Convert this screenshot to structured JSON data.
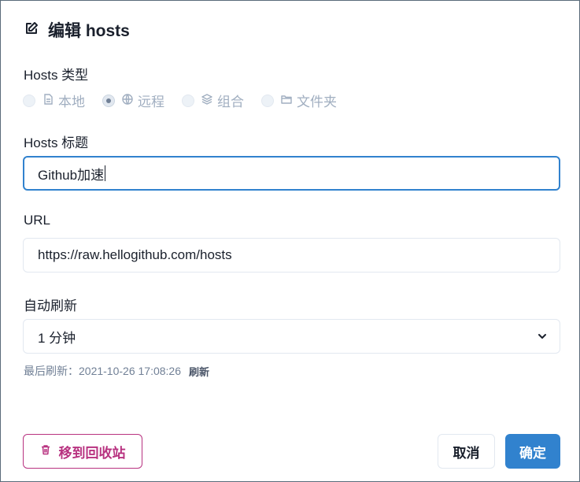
{
  "dialog": {
    "title": "编辑 hosts"
  },
  "hosts_type": {
    "label": "Hosts 类型",
    "options": [
      {
        "label": "本地",
        "icon": "file-icon",
        "selected": false
      },
      {
        "label": "远程",
        "icon": "globe-icon",
        "selected": true
      },
      {
        "label": "组合",
        "icon": "layers-icon",
        "selected": false
      },
      {
        "label": "文件夹",
        "icon": "folder-icon",
        "selected": false
      }
    ]
  },
  "hosts_title": {
    "label": "Hosts 标题",
    "value": "Github加速"
  },
  "url": {
    "label": "URL",
    "value": "https://raw.hellogithub.com/hosts"
  },
  "auto_refresh": {
    "label": "自动刷新",
    "selected": "1 分钟"
  },
  "last_refresh": {
    "text": "最后刷新：2021-10-26 17:08:26",
    "refresh_label": "刷新"
  },
  "buttons": {
    "trash": "移到回收站",
    "cancel": "取消",
    "ok": "确定"
  },
  "colors": {
    "accent": "#3182ce",
    "danger": "#b83280",
    "muted": "#a0aec0"
  }
}
